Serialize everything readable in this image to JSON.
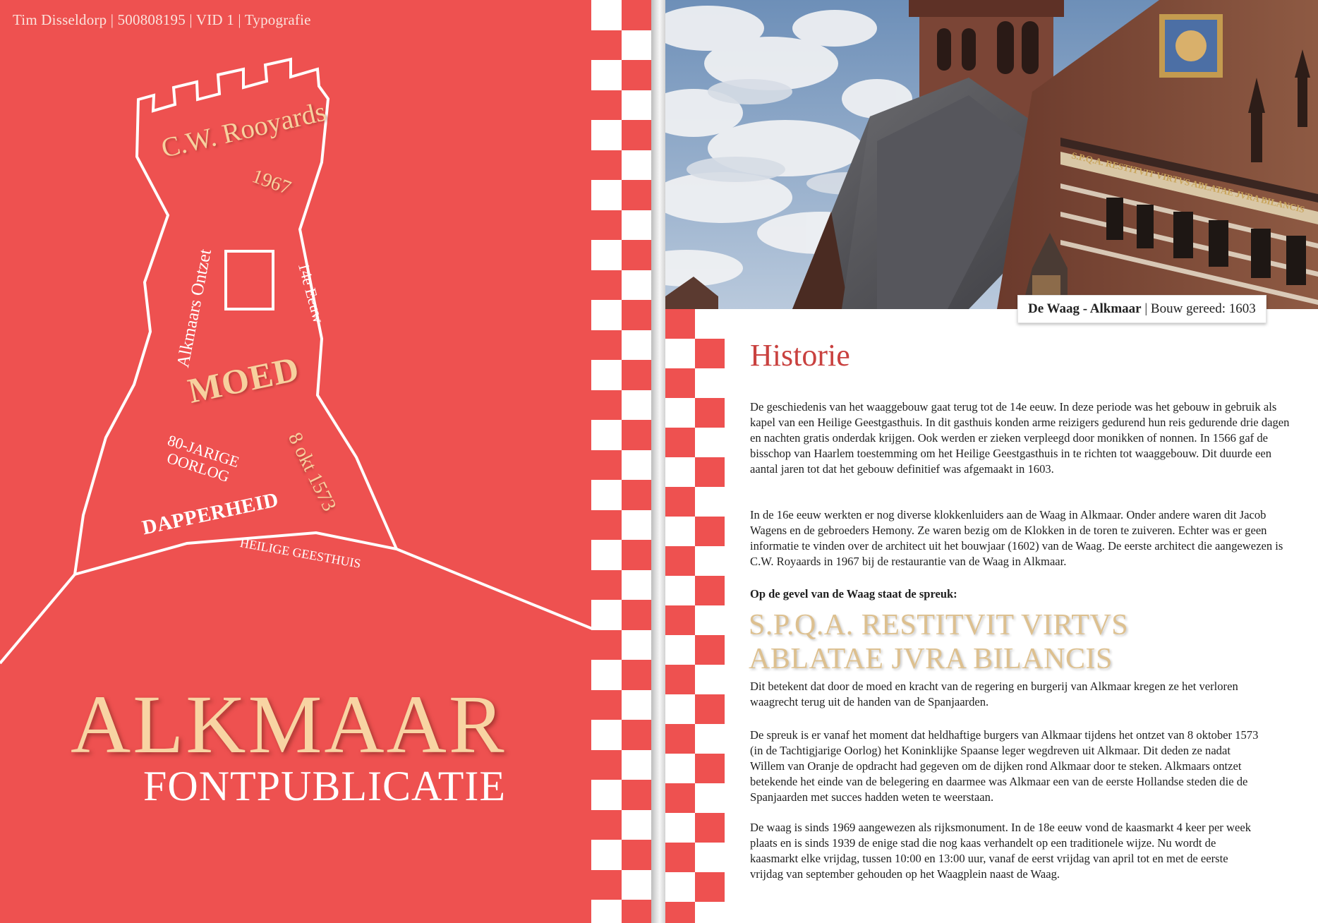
{
  "header": {
    "meta": "Tim Disseldorp | 500808195 | VID 1 | Typografie"
  },
  "tower": {
    "name": "C.W. Rooyards",
    "year": "1967",
    "ontzet": "Alkmaars Ontzet",
    "eeuw": "14e Eeuw",
    "moed": "MOED",
    "oorlog_line1": "80-JARIGE",
    "oorlog_line2": "OORLOG",
    "date": "8 okt 1573",
    "dapperheid": "DAPPERHEID",
    "geesthuis": "HEILIGE GEESTHUIS"
  },
  "cover": {
    "title": "ALKMAAR",
    "subtitle": "FONTPUBLICATIE"
  },
  "photo": {
    "inscription": "S.P.Q.A. RESTITVIT VIRTVS ABLATAE JVRA BILANCIS",
    "caption_bold": "De Waag - Alkmaar",
    "caption_rest": " | Bouw gereed: 1603"
  },
  "article": {
    "title": "Historie",
    "paragraph_1": "De geschiedenis van het waaggebouw gaat terug tot de 14e eeuw. In deze periode was het gebouw in gebruik als kapel van een Heilige Geestgasthuis. In dit gasthuis konden arme reizigers gedurend hun reis gedurende drie dagen en nachten gratis onderdak krijgen. Ook werden er zieken verpleegd door monikken of nonnen. In 1566 gaf de bisschop van Haarlem toestemming om het Heilige Geestgasthuis in te richten tot waaggebouw. Dit duurde een aantal jaren tot dat het gebouw definitief was afgemaakt in 1603.",
    "paragraph_2": "In de 16e eeuw werkten er nog diverse klokkenluiders aan de Waag in Alkmaar. Onder andere waren dit Jacob Wagens en de gebroeders Hemony. Ze waren bezig om de Klokken in de toren te zuiveren. Echter was er geen informatie te vinden over de architect uit het bouwjaar (1602) van de Waag. De eerste architect die aangewezen is C.W. Royaards in 1967 bij de restaurantie van de Waag in Alkmaar.",
    "lead": "Op de gevel van de Waag staat de spreuk:",
    "motto_line1": "S.P.Q.A. RESTITVIT VIRTVS",
    "motto_line2": "ABLATAE JVRA BILANCIS",
    "paragraph_3": "Dit betekent dat door de moed en kracht van de regering en burgerij van Alkmaar kregen ze het verloren waagrecht terug uit de handen van de Spanjaarden.",
    "paragraph_4": "De spreuk is er vanaf het moment dat heldhaftige burgers van Alkmaar tijdens het ontzet van 8 oktober 1573 (in de Tachtigjarige Oorlog) het Koninklijke Spaanse leger wegdreven uit Alkmaar. Dit deden ze nadat Willem van Oranje de opdracht had gegeven om de dijken rond Alkmaar door te steken. Alkmaars ontzet betekende het einde van de belegering en daarmee was Alkmaar een van de eerste Hollandse steden die de Spanjaarden met succes hadden weten te weerstaan.",
    "paragraph_5": "De waag is sinds 1969 aangewezen als rijksmonument. In de 18e eeuw vond de kaasmarkt 4 keer per week plaats en is sinds 1939 de enige stad die nog kaas verhandelt op een traditionele wijze. Nu wordt de kaasmarkt elke vrijdag, tussen 10:00 en 13:00 uur, vanaf de eerst vrijdag van april tot en met de eerste vrijdag van september gehouden op het Waagplein naast de Waag."
  },
  "colors": {
    "red": "#ee5150",
    "gold": "#f7d09e",
    "title_red": "#c9413f",
    "motto_gold": "#ddc08f"
  }
}
